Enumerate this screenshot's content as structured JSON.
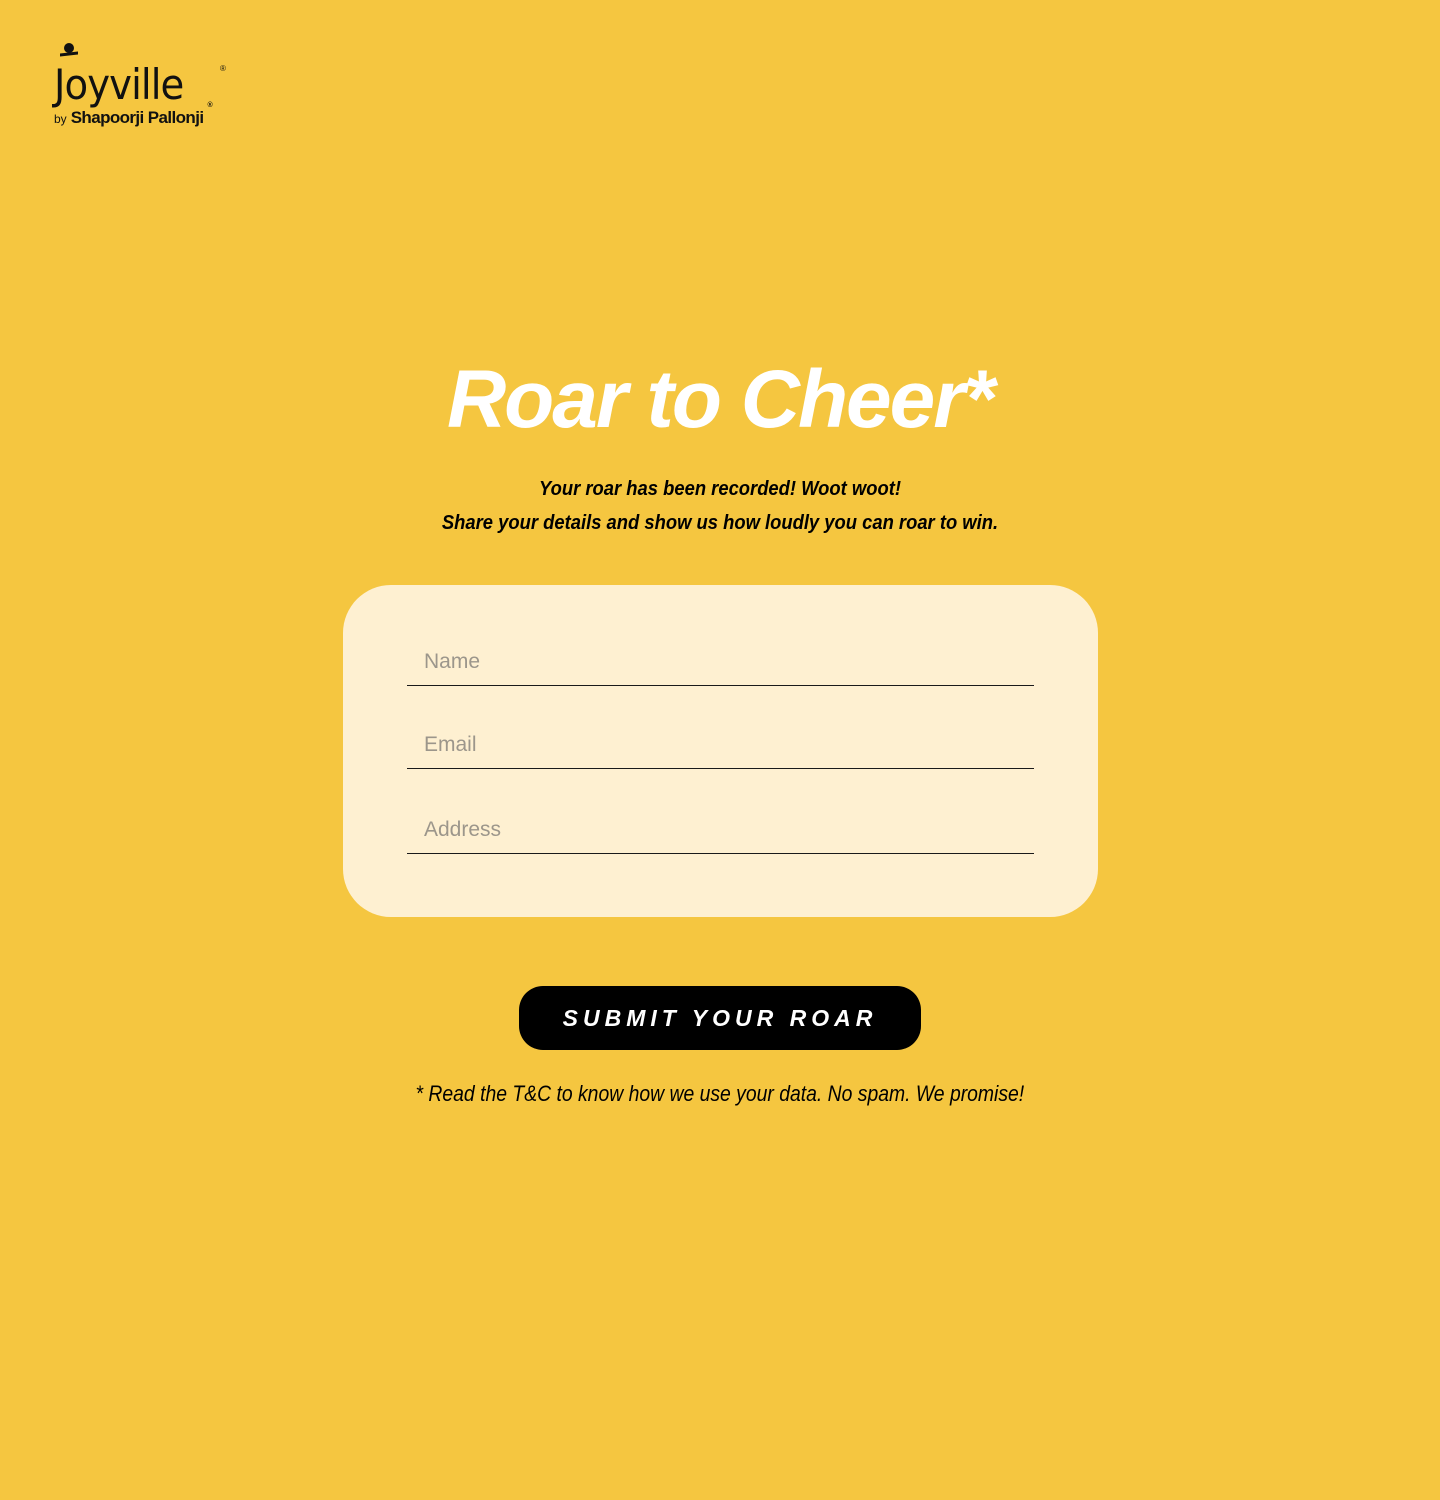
{
  "brand": {
    "logo_text": "Joyville",
    "by": "by",
    "company": "Shapoorji Pallonji",
    "registered": "®"
  },
  "hero": {
    "title": "Roar to Cheer*",
    "subtitle_line1": "Your roar has been recorded! Woot woot!",
    "subtitle_line2": "Share your details and show us how loudly you can roar to win."
  },
  "form": {
    "name_placeholder": "Name",
    "email_placeholder": "Email",
    "address_placeholder": "Address",
    "name_value": "",
    "email_value": "",
    "address_value": ""
  },
  "submit_label": "SUBMIT YOUR ROAR",
  "disclaimer": "* Read the T&C to know how we use your data. No spam. We promise!",
  "colors": {
    "background": "#F5C640",
    "card": "#FEF0D1",
    "button": "#000000",
    "title": "#FFFFFF"
  }
}
